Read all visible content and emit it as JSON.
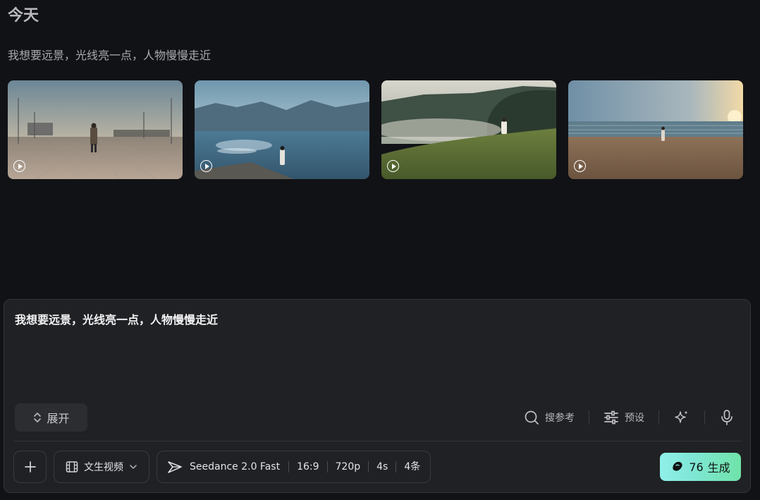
{
  "section": {
    "title": "今天"
  },
  "history": {
    "prompt": "我想要远景，光线亮一点，人物慢慢走近"
  },
  "thumbnails": [
    {
      "scene": "plaza"
    },
    {
      "scene": "lake"
    },
    {
      "scene": "meadow"
    },
    {
      "scene": "beach"
    }
  ],
  "composer": {
    "text": "我想要远景，光线亮一点，人物慢慢走近",
    "expand_label": "展开",
    "tools": {
      "search_ref_label": "搜参考",
      "preset_label": "预设"
    },
    "mode_label": "文生视频",
    "model": {
      "name": "Seedance 2.0 Fast",
      "ratio": "16:9",
      "resolution": "720p",
      "duration": "4s",
      "count": "4条"
    },
    "generate": {
      "credits": "76",
      "label": "生成"
    }
  },
  "icons": {
    "play": "play-circle-icon",
    "expand": "chevron-updown-icon",
    "search": "search-icon",
    "preset": "sliders-icon",
    "magic": "sparkle-icon",
    "mic": "microphone-icon",
    "plus": "plus-icon",
    "film": "film-icon",
    "chevron": "chevron-down-icon",
    "model": "seedance-logo-icon",
    "credits": "bean-icon"
  },
  "colors": {
    "background": "#111216",
    "panel": "#202124",
    "generate_gradient_start": "#8ff0e9",
    "generate_gradient_end": "#6fe3a8"
  }
}
